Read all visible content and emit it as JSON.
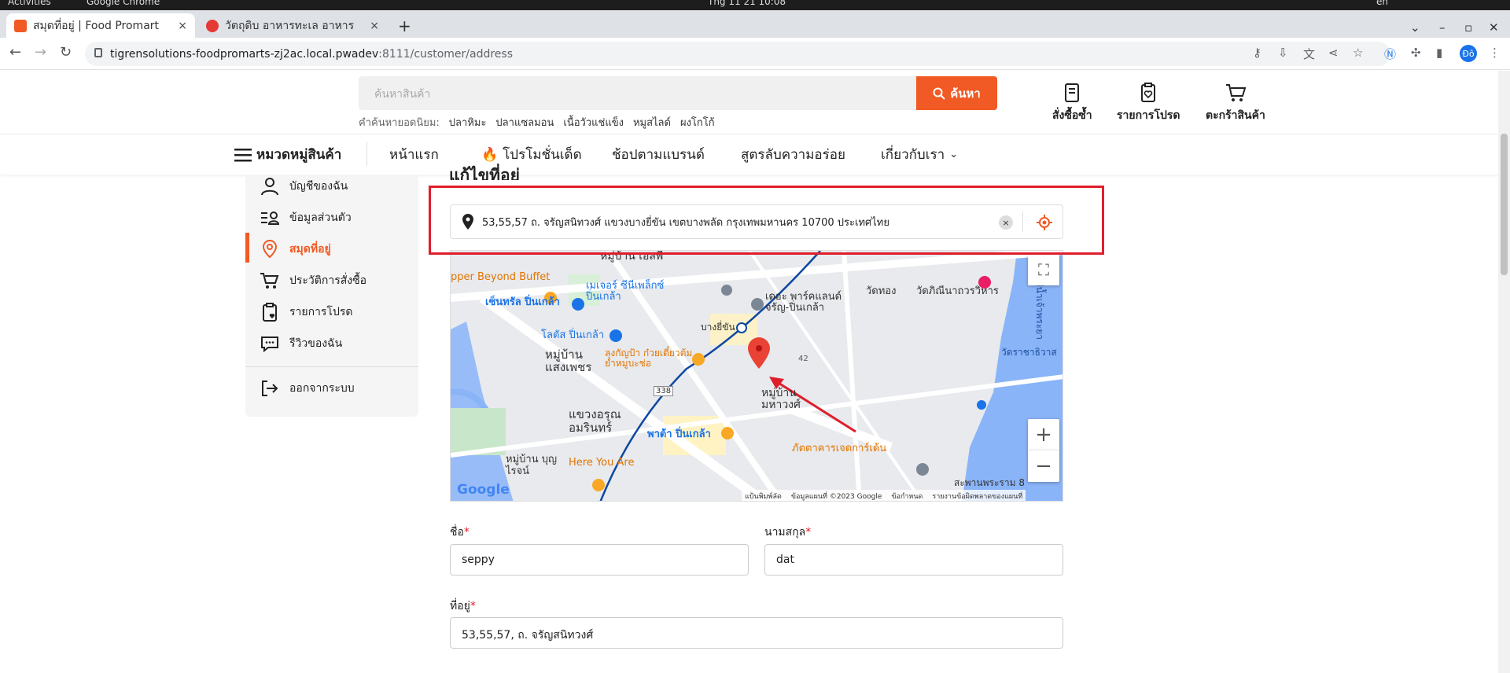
{
  "os": {
    "activities": "Activities",
    "app": "Google Chrome",
    "clock": "Thg 11 21  10:08",
    "lang": "en"
  },
  "browser": {
    "tabs": [
      {
        "title": "สมุดที่อยู่ | Food Promart",
        "close": "×"
      },
      {
        "title": "วัตถุดิบ อาหารทะเล อาหาร",
        "close": "×"
      }
    ],
    "new_tab": "+",
    "url_host": "tigrensolutions-foodpromarts-zj2ac.local.pwadev",
    "url_path": ":8111/customer/address",
    "profile_initials": "Đô"
  },
  "header": {
    "search_placeholder": "ค้นหาสินค้า",
    "search_button": "ค้นหา",
    "popular_label": "คำค้นหายอดนิยม:",
    "popular_keywords": [
      "ปลาหิมะ",
      "ปลาแซลมอน",
      "เนื้อวัวแช่แข็ง",
      "หมูสไลด์",
      "ผงโกโก้"
    ],
    "actions": [
      {
        "label": "สั่งซื้อซ้ำ",
        "icon": "reorder-icon"
      },
      {
        "label": "รายการโปรด",
        "icon": "wishlist-icon"
      },
      {
        "label": "ตะกร้าสินค้า",
        "icon": "cart-icon"
      }
    ]
  },
  "nav": {
    "categories": "หมวดหมู่สินค้า",
    "items": [
      "หน้าแรก",
      "โปรโมชั่นเด็ด",
      "ช้อปตามแบรนด์",
      "สูตรลับความอร่อย",
      "เกี่ยวกับเรา"
    ]
  },
  "sidebar": {
    "items": [
      {
        "label": "บัญชีของฉัน",
        "icon": "user-icon"
      },
      {
        "label": "ข้อมูลส่วนตัว",
        "icon": "profile-list-icon"
      },
      {
        "label": "สมุดที่อยู่",
        "icon": "location-pin-icon"
      },
      {
        "label": "ประวัติการสั่งซื้อ",
        "icon": "cart-history-icon"
      },
      {
        "label": "รายการโปรด",
        "icon": "clipboard-heart-icon"
      },
      {
        "label": "รีวิวของฉัน",
        "icon": "chat-bubble-icon"
      },
      {
        "label": "ออกจากระบบ",
        "icon": "logout-icon"
      }
    ],
    "active_index": 2
  },
  "main": {
    "title": "แก้ไขที่อยู่",
    "address_search_value": "53,55,57 ถ. จรัญสนิทวงศ์ แขวงบางยี่ขัน เขตบางพลัด กรุงเทพมหานคร 10700 ประเทศไทย",
    "clear": "×"
  },
  "map": {
    "labels": [
      "หมู่บ้าน เอสพี",
      "pper Beyond Buffet",
      "เมเจอร์ ซีนีเพล็กซ์ ปิ่นเกล้า",
      "เซ็นทรัล ปิ่นเกล้า",
      "เดอะ พาร์คแลนด์ จรัญ-ปิ่นเกล้า",
      "วัดทอง",
      "วัดภิณีนาถวรวิหาร",
      "โลตัส ปิ่นเกล้า",
      "บางยี่ขัน",
      "หมู่บ้าน แสงเพชร",
      "ลุงกัญป้า ก๋วยเตี๋ยวต้มยำหมูบะช่อ",
      "วัดราชาธิวาส",
      "หมู่บ้าน มหาวงศ์",
      "แขวงอรุณ อมรินทร์",
      "พาต้า ปิ่นเกล้า",
      "ภัตตาคารเจดการ์เด้น",
      "Here You Are",
      "หมู่บ้าน บุญไรจน์",
      "แม่น้ำเจ้าพระยา",
      "สะพานพระราม 8",
      "338",
      "42"
    ],
    "footer": [
      "แป้นพิมพ์ลัด",
      "ข้อมูลแผนที่ ©2023 Google",
      "ข้อกำหนด",
      "รายงานข้อผิดพลาดของแผนที่"
    ],
    "logo": "Google",
    "zoom_in": "+",
    "zoom_out": "−"
  },
  "form": {
    "first_name_label": "ชื่อ",
    "first_name_value": "seppy",
    "last_name_label": "นามสกุล",
    "last_name_value": "dat",
    "address_label": "ที่อยู่",
    "address_value": "53,55,57, ถ. จรัญสนิทวงศ์",
    "required_mark": "*"
  },
  "colors": {
    "accent": "#f15a24",
    "highlight": "#e01e2b",
    "water": "#8ab4f8",
    "map_bg": "#e8eaed",
    "rail": "#0d47a1"
  }
}
